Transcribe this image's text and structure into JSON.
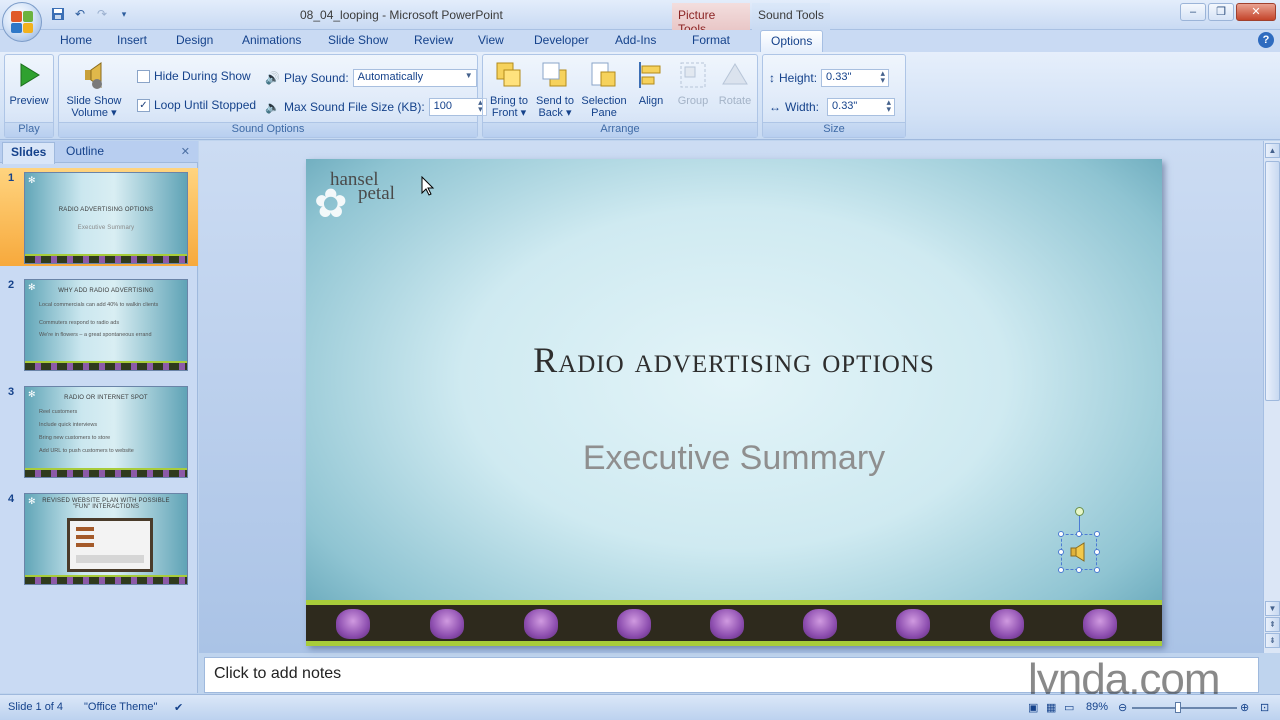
{
  "window": {
    "title": "08_04_looping - Microsoft PowerPoint",
    "context_tabs": [
      "Picture Tools",
      "Sound Tools"
    ],
    "controls": [
      "minimize",
      "maximize",
      "close"
    ]
  },
  "qat": [
    "save-icon",
    "undo-icon",
    "redo-icon",
    "customize-icon"
  ],
  "tabs": [
    "Home",
    "Insert",
    "Design",
    "Animations",
    "Slide Show",
    "Review",
    "View",
    "Developer",
    "Add-Ins",
    "Format",
    "Options"
  ],
  "active_tab": "Options",
  "ribbon": {
    "play": {
      "label": "Play",
      "preview": "Preview"
    },
    "sound": {
      "label": "Sound Options",
      "slide_show_volume": "Slide Show Volume ▾",
      "hide_during_show": "Hide During Show",
      "hide_checked": false,
      "loop_until_stopped": "Loop Until Stopped",
      "loop_checked": true,
      "play_sound_label": "Play Sound:",
      "play_sound_value": "Automatically",
      "max_size_label": "Max Sound File Size (KB):",
      "max_size_value": "100"
    },
    "arrange": {
      "label": "Arrange",
      "bring_to_front": "Bring to Front ▾",
      "send_to_back": "Send to Back ▾",
      "selection_pane": "Selection Pane",
      "align": "Align",
      "group": "Group",
      "rotate": "Rotate"
    },
    "size": {
      "label": "Size",
      "height_label": "Height:",
      "height_value": "0.33\"",
      "width_label": "Width:",
      "width_value": "0.33\""
    }
  },
  "panel": {
    "tabs": [
      "Slides",
      "Outline"
    ],
    "slides": [
      {
        "num": "1",
        "title": "Radio advertising options",
        "bullets": [
          "Executive Summary"
        ]
      },
      {
        "num": "2",
        "title": "Why Add Radio Advertising",
        "bullets": [
          "Local commercials can add 40% to walkin clients",
          "Commuters respond to radio ads",
          "We're in flowers – a great spontaneous errand"
        ]
      },
      {
        "num": "3",
        "title": "Radio or Internet spot",
        "bullets": [
          "Reel customers",
          "Include quick interviews",
          "Bring new customers to store",
          "Add URL to push customers to website"
        ]
      },
      {
        "num": "4",
        "title": "Revised website plan with possible \"fun\" interactions",
        "bullets": []
      }
    ]
  },
  "slide": {
    "brand_line1": "hansel",
    "brand_line2": "petal",
    "title": "Radio advertising options",
    "subtitle": "Executive Summary"
  },
  "notes_placeholder": "Click to add notes",
  "status": {
    "slide_info": "Slide 1 of 4",
    "theme": "\"Office Theme\"",
    "zoom": "89%"
  },
  "watermark": "lynda.com",
  "colors": {
    "ribbon": "#d3e2f6",
    "selected_thumb": "#f7a93c",
    "slide_band": "#2e2a1d",
    "accent_green": "#a8cc3a",
    "tulip": "#8e4fb0"
  }
}
